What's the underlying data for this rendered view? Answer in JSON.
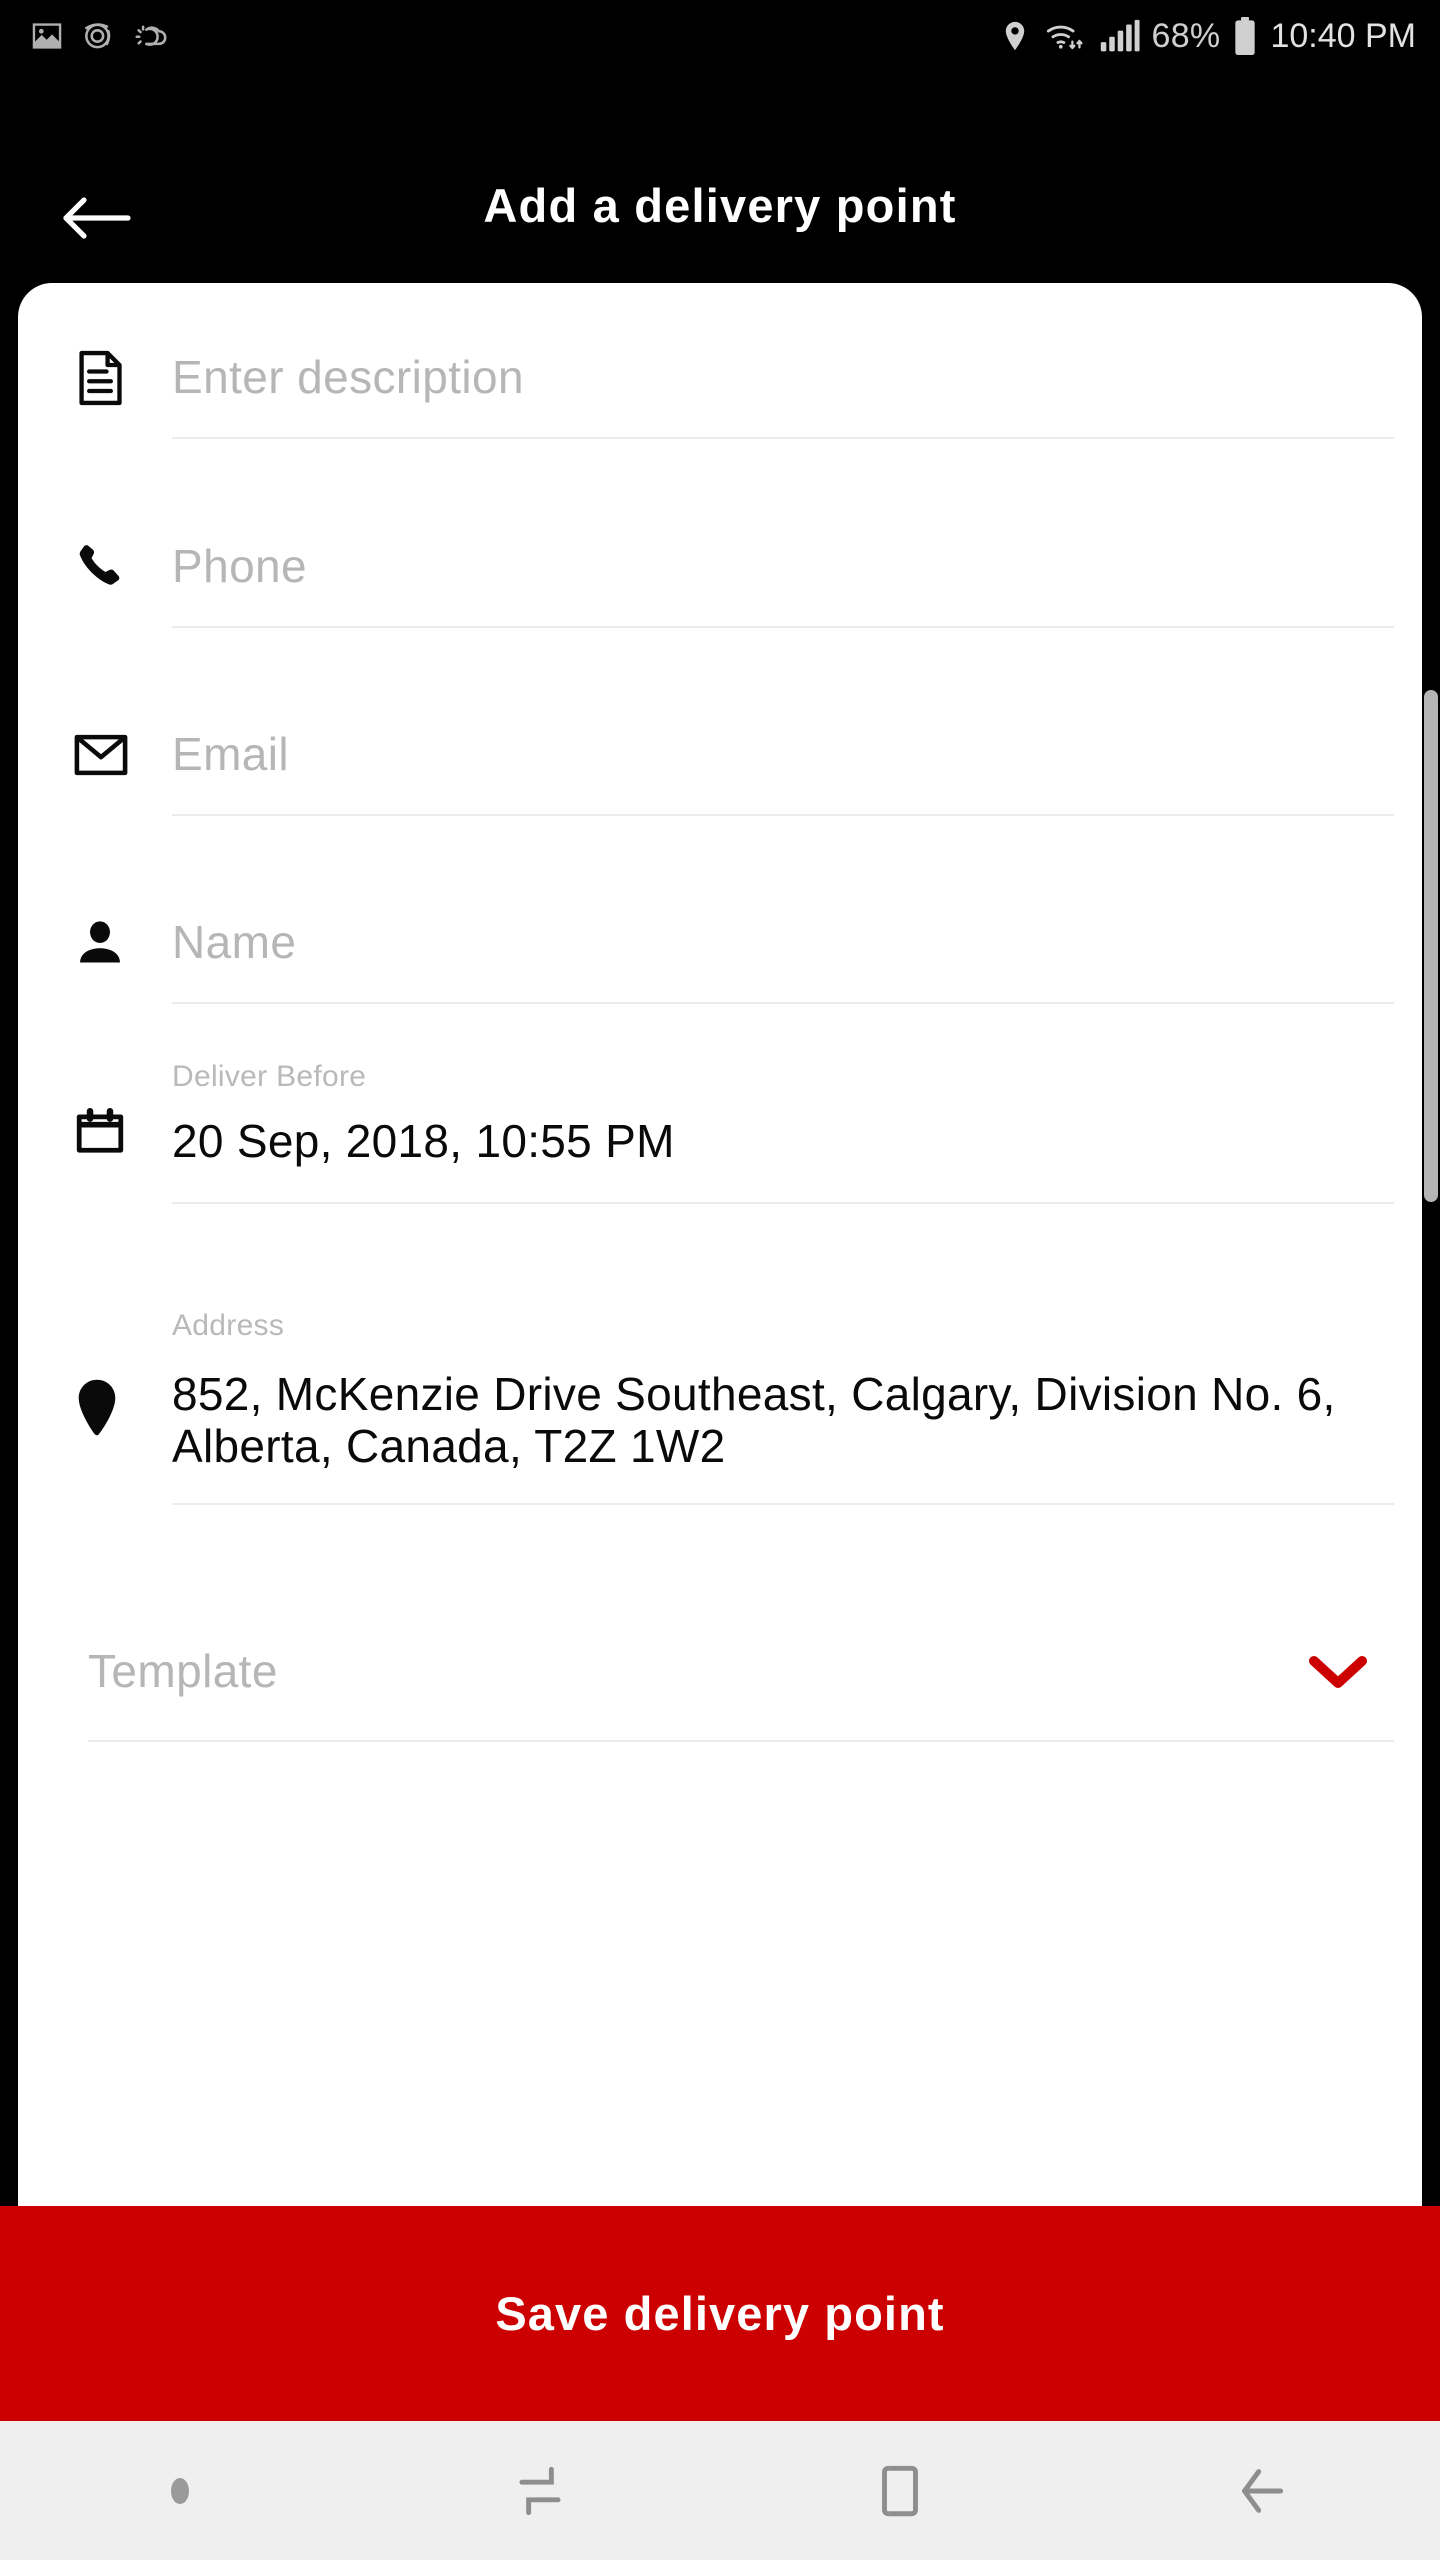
{
  "status_bar": {
    "left_icons": [
      "image-icon",
      "spiral-icon",
      "weather-icon"
    ],
    "right_icons": [
      "location-pin-icon",
      "wifi-icon",
      "signal-bars-icon",
      "battery-icon"
    ],
    "battery_percent": "68%",
    "time": "10:40 PM"
  },
  "app_bar": {
    "back_icon": "arrow-left-icon",
    "title": "Add a delivery point"
  },
  "form": {
    "description": {
      "icon": "document-icon",
      "placeholder": "Enter description",
      "value": ""
    },
    "phone": {
      "icon": "phone-icon",
      "placeholder": "Phone",
      "value": ""
    },
    "email": {
      "icon": "envelope-icon",
      "placeholder": "Email",
      "value": ""
    },
    "name": {
      "icon": "person-icon",
      "placeholder": "Name",
      "value": ""
    },
    "deliver_before": {
      "icon": "calendar-icon",
      "label": "Deliver Before",
      "value": "20 Sep, 2018, 10:55 PM"
    },
    "address": {
      "icon": "location-pin-icon",
      "label": "Address",
      "value": "852, McKenzie Drive Southeast, Calgary, Division No. 6, Alberta, Canada, T2Z 1W2"
    },
    "template": {
      "placeholder": "Template",
      "value": "",
      "chevron_icon": "chevron-down-icon"
    }
  },
  "save_button": {
    "label": "Save delivery point"
  },
  "nav_bar": {
    "items": [
      "dot-indicator",
      "recents-icon",
      "home-icon",
      "back-icon"
    ]
  },
  "colors": {
    "accent_red": "#cc0000",
    "chevron_red": "#cc0000",
    "app_bar_bg": "#000000",
    "card_bg": "#ffffff",
    "nav_bar_bg": "#efefef",
    "placeholder_grey": "#b6b6b6",
    "label_grey": "#b9b9b9",
    "underline_grey": "#ececec"
  }
}
